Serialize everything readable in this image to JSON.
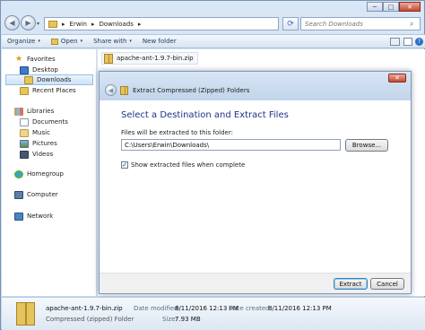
{
  "window": {
    "minimize": "─",
    "maximize": "□",
    "close": "✕"
  },
  "address": {
    "back": "◀",
    "forward": "▶",
    "dropdown": "▾",
    "crumbs": [
      "Erwin",
      "Downloads"
    ],
    "sep": "▸",
    "refresh": "⟳",
    "search_placeholder": "Search Downloads"
  },
  "toolbar": {
    "organize": "Organize",
    "open": "Open",
    "share": "Share with",
    "new_folder": "New folder",
    "arrow": "▾",
    "help": "?"
  },
  "nav": {
    "favorites": "Favorites",
    "desktop": "Desktop",
    "downloads": "Downloads",
    "recent": "Recent Places",
    "libraries": "Libraries",
    "documents": "Documents",
    "music": "Music",
    "pictures": "Pictures",
    "videos": "Videos",
    "homegroup": "Homegroup",
    "computer": "Computer",
    "network": "Network"
  },
  "file": {
    "name": "apache-ant-1.9.7-bin.zip"
  },
  "dialog": {
    "title": "Extract Compressed (Zipped) Folders",
    "close": "✕",
    "back": "◀",
    "heading": "Select a Destination and Extract Files",
    "label": "Files will be extracted to this folder:",
    "path": "C:\\Users\\Erwin\\Downloads\\",
    "browse": "Browse...",
    "checkbox_label": "Show extracted files when complete",
    "checkbox_checked": true,
    "check_mark": "✓",
    "extract": "Extract",
    "cancel": "Cancel"
  },
  "details": {
    "name": "apache-ant-1.9.7-bin.zip",
    "type": "Compressed (zipped) Folder",
    "modified_label": "Date modified:",
    "modified": "8/11/2016 12:13 PM",
    "created_label": "Date created:",
    "created": "8/11/2016 12:13 PM",
    "size_label": "Size:",
    "size": "7.93 MB"
  }
}
